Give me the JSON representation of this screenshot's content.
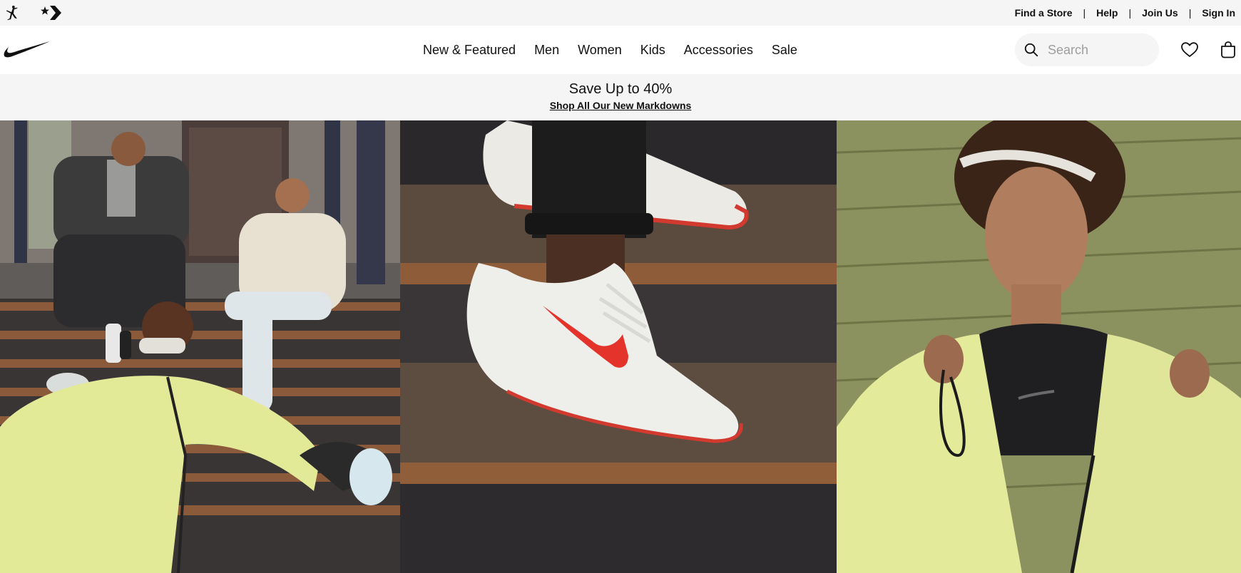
{
  "utility": {
    "brands": [
      {
        "name": "Jordan",
        "icon": "jumpman-icon"
      },
      {
        "name": "Converse",
        "icon": "converse-star-chevron-icon"
      }
    ],
    "links": [
      "Find a Store",
      "Help",
      "Join Us",
      "Sign In"
    ],
    "separator": "|"
  },
  "nav": {
    "logo": "nike-swoosh-logo",
    "menu": [
      "New & Featured",
      "Men",
      "Women",
      "Kids",
      "Accessories",
      "Sale"
    ],
    "search": {
      "placeholder": "Search",
      "value": "",
      "icon": "search-icon"
    },
    "favorites_icon": "heart-icon",
    "bag_icon": "bag-icon"
  },
  "promo": {
    "title": "Save Up to 40%",
    "link": "Shop All Our New Markdowns"
  },
  "hero": {
    "panels": [
      {
        "subject": "group-on-stoop-photo"
      },
      {
        "subject": "sneaker-closeup-photo"
      },
      {
        "subject": "woman-yellow-hoodie-photo"
      }
    ]
  },
  "colors": {
    "utility_bg": "#f5f5f5",
    "nav_bg": "#ffffff",
    "text": "#111111",
    "accent_red": "#e4332a",
    "hoodie_yellow": "#e6ee9c"
  }
}
